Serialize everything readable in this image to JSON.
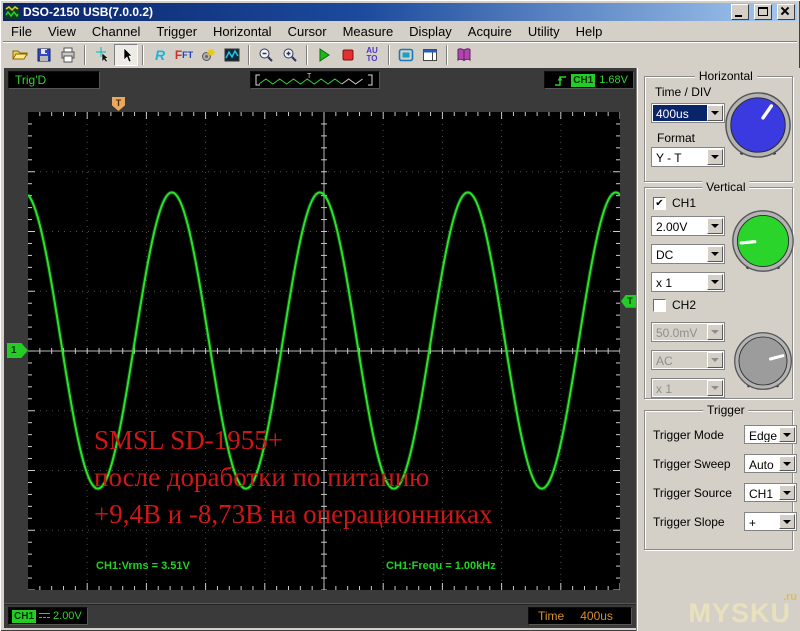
{
  "window": {
    "title": "DSO-2150 USB(7.0.0.2)"
  },
  "menu": {
    "items": [
      "File",
      "View",
      "Channel",
      "Trigger",
      "Horizontal",
      "Cursor",
      "Measure",
      "Display",
      "Acquire",
      "Utility",
      "Help"
    ]
  },
  "toolbar": {
    "items": [
      {
        "name": "open"
      },
      {
        "name": "save"
      },
      {
        "name": "print",
        "sep_after": true
      },
      {
        "name": "cursor-cross"
      },
      {
        "name": "pointer",
        "pressed": true,
        "sep_after": true
      },
      {
        "name": "refresh-r",
        "glyph": "R"
      },
      {
        "name": "fft",
        "glyph": "FFT"
      },
      {
        "name": "settings"
      },
      {
        "name": "waveform",
        "sep_after": true
      },
      {
        "name": "zoom-out"
      },
      {
        "name": "zoom-in",
        "sep_after": true
      },
      {
        "name": "run"
      },
      {
        "name": "stop"
      },
      {
        "name": "auto-set",
        "glyph": "AU TO",
        "sep_after": true
      },
      {
        "name": "display"
      },
      {
        "name": "window",
        "sep_after": true
      },
      {
        "name": "help"
      }
    ]
  },
  "status_top": {
    "trig_status": "Trig'D",
    "preview_marker": "T",
    "trigger_badge": "CH1",
    "trigger_level": "1.68V"
  },
  "scope": {
    "annotation": {
      "lines": [
        "SMSL SD-1955+",
        "после доработки по питанию",
        "+9,4В и -8,73В на операционниках"
      ],
      "color": "#d01616"
    },
    "measurements": {
      "left": "CH1:Vrms = 3.51V",
      "right": "CH1:Frequ = 1.00kHz"
    },
    "markers": {
      "trigger_position": "T",
      "channel1": "1",
      "trigger_level": "T"
    }
  },
  "panels": {
    "horizontal": {
      "title": "Horizontal",
      "time_div_label": "Time / DIV",
      "time_div_value": "400us",
      "format_label": "Format",
      "format_value": "Y - T",
      "knob_color": "#3a3ae0",
      "knob_angle_deg": 55
    },
    "vertical": {
      "title": "Vertical",
      "ch1": {
        "label": "CH1",
        "checked": true,
        "volts_div": "2.00V",
        "coupling": "DC",
        "probe": "x 1",
        "knob_color": "#2bd42b",
        "knob_angle_deg": 185
      },
      "ch2": {
        "label": "CH2",
        "checked": false,
        "volts_div": "50.0mV",
        "coupling": "AC",
        "probe": "x 1",
        "knob_color": "#9c9c9c",
        "knob_angle_deg": 15
      }
    },
    "trigger": {
      "title": "Trigger",
      "rows": [
        {
          "label": "Trigger Mode",
          "value": "Edge"
        },
        {
          "label": "Trigger Sweep",
          "value": "Auto"
        },
        {
          "label": "Trigger Source",
          "value": "CH1"
        },
        {
          "label": "Trigger Slope",
          "value": "+"
        }
      ]
    }
  },
  "status_bottom": {
    "channel_badge": "CH1",
    "volts": "2.00V",
    "time_label": "Time",
    "time_value": "400us"
  },
  "watermark": {
    "text": "MYSKU",
    "suffix": ".ru"
  },
  "chart_data": {
    "type": "line",
    "signal": "sine",
    "title": "",
    "x_axis": {
      "time_per_div": "400us",
      "divisions": 10,
      "total_time_ms": 4.0
    },
    "y_axis": {
      "volts_per_div": 2.0,
      "volts_per_div_label": "2.00V",
      "divisions": 8
    },
    "frequency_hz": 1000,
    "period_divisions": 2.5,
    "cycles_visible": 4,
    "vrms_v": 3.51,
    "vpeak_v": 4.96,
    "dc_offset_v": 0.35,
    "peak_at_division": 2.43,
    "trigger_level_v": 1.68,
    "trigger_position_division": 1.52,
    "trace_color": "#2be32b",
    "grid": {
      "style": "dotted",
      "center_cross": true
    }
  }
}
